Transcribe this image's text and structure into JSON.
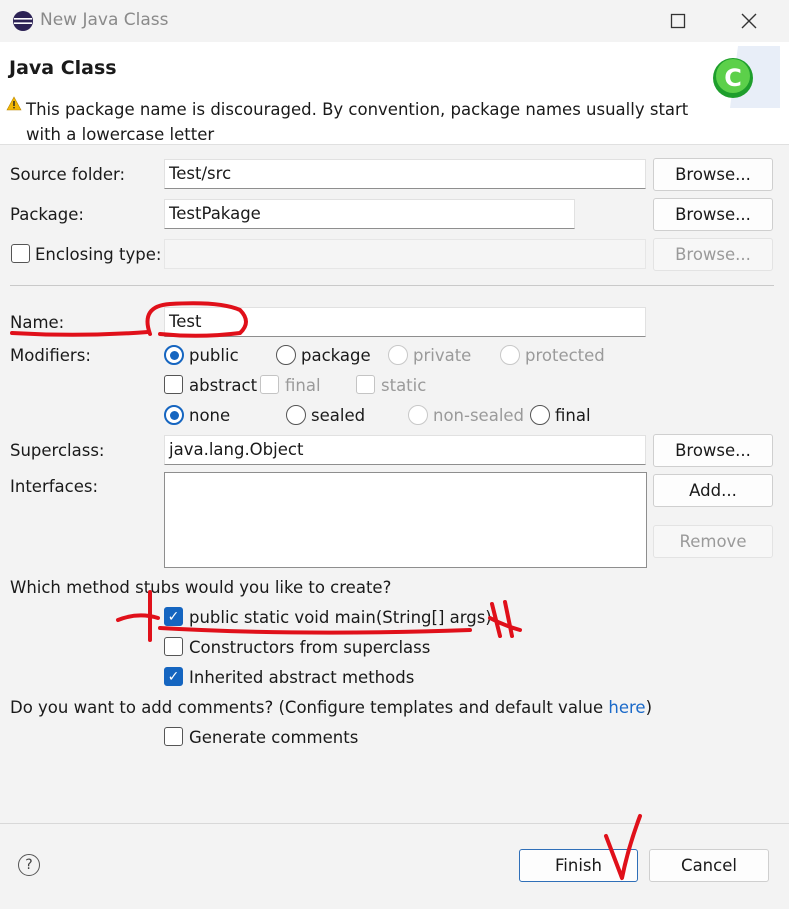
{
  "window": {
    "title": "New Java Class"
  },
  "header": {
    "title": "Java Class",
    "warning": "This package name is discouraged. By convention, package names usually start with a lowercase letter"
  },
  "fields": {
    "source_folder_label": "Source folder:",
    "source_folder_value": "Test/src",
    "package_label": "Package:",
    "package_value": "TestPakage",
    "enclosing_label": "Enclosing type:",
    "name_label": "Name:",
    "name_value": "Test",
    "modifiers_label": "Modifiers:",
    "superclass_label": "Superclass:",
    "superclass_value": "java.lang.Object",
    "interfaces_label": "Interfaces:"
  },
  "buttons": {
    "browse": "Browse...",
    "add": "Add...",
    "remove": "Remove",
    "finish": "Finish",
    "cancel": "Cancel"
  },
  "modifiers": {
    "row1": {
      "public": "public",
      "package": "package",
      "private": "private",
      "protected": "protected"
    },
    "row2": {
      "abstract": "abstract",
      "final": "final",
      "static": "static"
    },
    "row3": {
      "none": "none",
      "sealed": "sealed",
      "non_sealed": "non-sealed",
      "final": "final"
    }
  },
  "stubs": {
    "question": "Which method stubs would you like to create?",
    "main": "public static void main(String[] args)",
    "constructors": "Constructors from superclass",
    "inherited": "Inherited abstract methods"
  },
  "comments": {
    "question": "Do you want to add comments? (Configure templates and default value",
    "link": "here",
    "close_paren": ")",
    "generate": "Generate comments"
  },
  "colors": {
    "accent": "#1565c0",
    "link": "#1b6ac9",
    "annotation": "#e0101a"
  }
}
